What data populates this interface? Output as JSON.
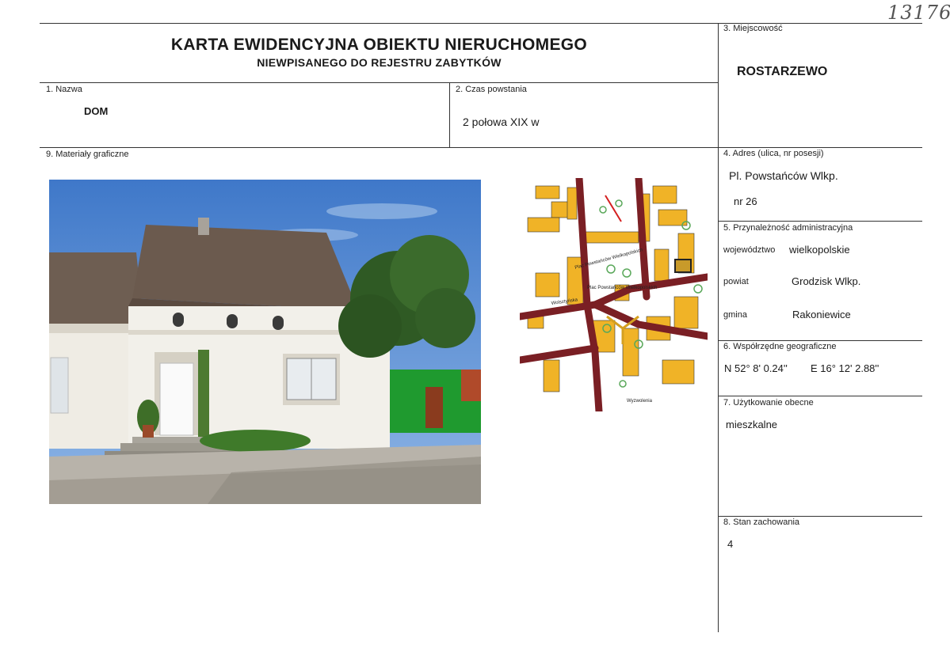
{
  "handwritten_number": "13176",
  "title": {
    "line1": "KARTA EWIDENCYJNA OBIEKTU NIERUCHOMEGO",
    "line2": "NIEWPISANEGO DO REJESTRU ZABYTKÓW"
  },
  "fields": {
    "miejscowosc": {
      "label": "3. Miejscowość",
      "value": "ROSTARZEWO"
    },
    "nazwa": {
      "label": "1. Nazwa",
      "value": "DOM"
    },
    "czas": {
      "label": "2. Czas powstania",
      "value": "2 połowa XIX w"
    },
    "materialy": {
      "label": "9. Materiały graficzne"
    },
    "adres": {
      "label": "4. Adres (ulica, nr posesji)",
      "line1": "Pl. Powstańców Wlkp.",
      "line2": "nr  26"
    },
    "przynaleznosc": {
      "label": "5. Przynależność administracyjna",
      "woj_label": "województwo",
      "woj_value": "wielkopolskie",
      "powiat_label": "powiat",
      "powiat_value": "Grodzisk Wlkp.",
      "gmina_label": "gmina",
      "gmina_value": "Rakoniewice"
    },
    "wspolrzedne": {
      "label": "6. Współrzędne geograficzne",
      "n": "N  52° 8' 0.24''",
      "e": "E 16° 12' 2.88''"
    },
    "uzytkowanie": {
      "label": "7. Użytkowanie obecne",
      "value": "mieszkalne"
    },
    "stan": {
      "label": "8. Stan zachowania",
      "value": "4"
    }
  },
  "map_labels": {
    "street1": "Plac Powstańców Wielkopolskich",
    "street2": "Plac Powstańców Wielkopolskich",
    "street3": "Wolsztyńska",
    "street4": "Wyzwolenia"
  },
  "colors": {
    "sky": "#5a8fd6",
    "roof": "#6b5a4e",
    "wall": "#f2f0ea",
    "tree": "#2f5a24",
    "green_wall": "#1f9a2f",
    "map_road": "#7a1f24",
    "map_building": "#f0b327"
  }
}
